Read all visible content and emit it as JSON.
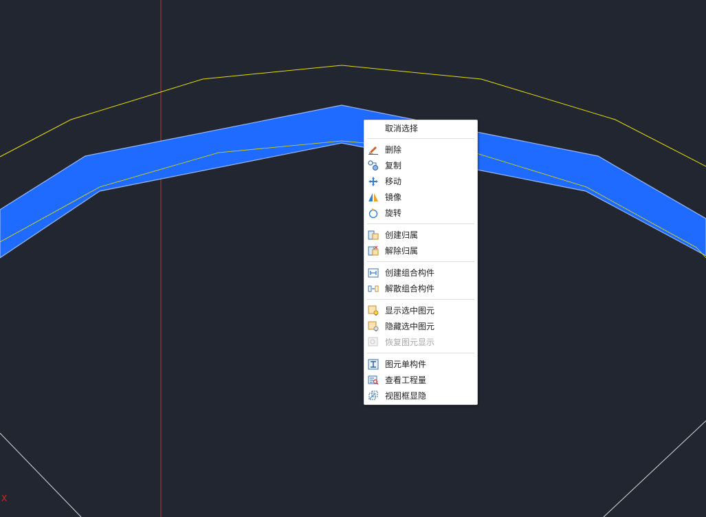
{
  "canvas": {
    "axis_label": "X",
    "colors": {
      "background": "#212630",
      "selected_fill": "#1f6bff",
      "selected_edge": "#8fb0ff",
      "yellow_line": "#e8e000",
      "red_axis": "#c0392b",
      "white_line": "#dddddd"
    }
  },
  "menu": {
    "cancel_select": "取消选择",
    "delete": "删除",
    "copy": "复制",
    "move": "移动",
    "mirror": "镜像",
    "rotate": "旋转",
    "create_attach": "创建归属",
    "remove_attach": "解除归属",
    "create_group": "创建组合构件",
    "ungroup": "解散组合构件",
    "show_selected": "显示选中图元",
    "hide_selected": "隐藏选中图元",
    "restore_display": "恢复图元显示",
    "single_component": "图元单构件",
    "view_quantity": "查看工程量",
    "viewframe_toggle": "视图框显隐"
  }
}
